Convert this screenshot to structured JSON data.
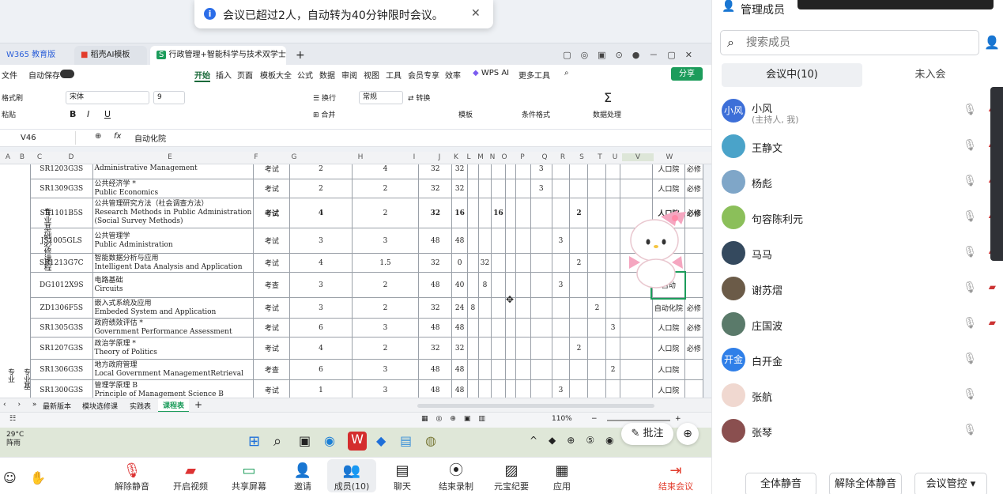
{
  "toast": {
    "text": "会议已超过2人，自动转为40分钟限时会议。",
    "close": "✕",
    "info": "i"
  },
  "tabs": [
    {
      "label": "W365 教育版"
    },
    {
      "label": "稻壳AI模板"
    },
    {
      "label": "行政管理+智能科学与技术双学士"
    },
    {
      "close": "✕",
      "add": "+"
    }
  ],
  "menu": {
    "file": "文件",
    "autosave": "自动保存",
    "items": [
      "开始",
      "插入",
      "页面",
      "模板大全",
      "公式",
      "数据",
      "审阅",
      "视图",
      "工具",
      "会员专享",
      "效率"
    ],
    "wpsai": "WPS AI",
    "more": "更多工具",
    "share": "分享"
  },
  "ribbon": {
    "format_painter": "格式刷",
    "paste": "粘贴",
    "font": "宋体",
    "size": "9",
    "wrap": "换行",
    "merge": "合并",
    "numfmt": "常规",
    "convert": "转换",
    "template": "模板",
    "condfmt": "条件格式",
    "dataproc": "数据处理",
    "bold": "B",
    "italic": "I",
    "underline": "U"
  },
  "formula_bar": {
    "cell": "V46",
    "fx": "fx",
    "content": "自动化院"
  },
  "columns": [
    "A",
    "B",
    "C",
    "D",
    "E",
    "F",
    "G",
    "H",
    "I",
    "J",
    "K",
    "L",
    "M",
    "N",
    "O",
    "P",
    "Q",
    "R",
    "S",
    "T",
    "U",
    "V",
    "W"
  ],
  "group_label_1": "专业基础必修课程",
  "group_label_2": "专业",
  "group_label_3": "专业基",
  "rows": [
    {
      "code": "SR1203G3S",
      "cn": "",
      "en": "Administrative Management",
      "exam": "考试",
      "g": "2",
      "h": "4",
      "i": "32",
      "j": "32",
      "k": "",
      "l": "",
      "m": "",
      "p": "3",
      "q": "",
      "r": "",
      "s": "",
      "t": "",
      "v": "人口院",
      "w": "必修"
    },
    {
      "code": "SR1309G3S",
      "cn": "公共经济学 *",
      "en": "Public Economics",
      "exam": "考试",
      "g": "2",
      "h": "2",
      "i": "32",
      "j": "32",
      "k": "",
      "l": "",
      "m": "",
      "p": "3",
      "q": "",
      "r": "",
      "s": "",
      "t": "",
      "v": "人口院",
      "w": "必修"
    },
    {
      "code": "SR1101B5S",
      "cn": "公共管理研究方法（社会调查方法）",
      "en": "Research Methods in Public Administration",
      "en2": "(Social Survey Methods)",
      "exam": "考试",
      "g": "4",
      "h": "2",
      "i": "32",
      "j": "16",
      "k": "",
      "l": "",
      "m": "16",
      "p": "",
      "q": "",
      "r": "2",
      "s": "",
      "t": "",
      "v": "人口院",
      "w": "必修"
    },
    {
      "code": "JS1005GLS",
      "cn": "公共管理学",
      "en": "Public Administration",
      "exam": "考试",
      "g": "3",
      "h": "3",
      "i": "48",
      "j": "48",
      "k": "",
      "l": "",
      "m": "",
      "p": "",
      "q": "3",
      "r": "",
      "s": "",
      "t": "",
      "v": "",
      "w": ""
    },
    {
      "code": "SR1213G7C",
      "cn": "智能数据分析与应用",
      "en": "Intelligent Data Analysis and Application",
      "exam": "考试",
      "g": "4",
      "h": "1.5",
      "i": "32",
      "j": "0",
      "k": "",
      "l": "32",
      "m": "",
      "p": "",
      "q": "",
      "r": "2",
      "s": "",
      "t": "",
      "v": "",
      "w": ""
    },
    {
      "code": "DG1012X9S",
      "cn": "电路基础",
      "en": "Circuits",
      "exam": "考查",
      "g": "3",
      "h": "2",
      "i": "48",
      "j": "40",
      "k": "",
      "l": "8",
      "m": "",
      "p": "",
      "q": "3",
      "r": "",
      "s": "",
      "t": "",
      "v": "自动",
      "w": ""
    },
    {
      "code": "ZD1306F5S",
      "cn": "嵌入式系统及应用",
      "en": "Embeded System and Application",
      "exam": "考试",
      "g": "3",
      "h": "2",
      "i": "32",
      "j": "24",
      "k": "8",
      "l": "",
      "m": "",
      "p": "",
      "q": "",
      "r": "",
      "s": "2",
      "t": "",
      "v": "自动化院",
      "w": "必修"
    },
    {
      "code": "SR1305G3S",
      "cn": "政府绩效评估 *",
      "en": "Government Performance Assessment",
      "exam": "考试",
      "g": "6",
      "h": "3",
      "i": "48",
      "j": "48",
      "k": "",
      "l": "",
      "m": "",
      "p": "",
      "q": "",
      "r": "",
      "s": "",
      "t": "3",
      "v": "人口院",
      "w": "必修"
    },
    {
      "code": "SR1207G3S",
      "cn": "政治学原理 *",
      "en": "Theory of Politics",
      "exam": "考试",
      "g": "4",
      "h": "2",
      "i": "32",
      "j": "32",
      "k": "",
      "l": "",
      "m": "",
      "p": "",
      "q": "",
      "r": "2",
      "s": "",
      "t": "",
      "v": "人口院",
      "w": "必修"
    },
    {
      "code": "SR1306G3S",
      "cn": "地方政府管理",
      "en": "Local Government ManagementRetrieval",
      "exam": "考查",
      "g": "6",
      "h": "3",
      "i": "48",
      "j": "48",
      "k": "",
      "l": "",
      "m": "",
      "p": "",
      "q": "",
      "r": "",
      "s": "",
      "t": "2",
      "v": "人口院",
      "w": ""
    },
    {
      "code": "SR1300G3S",
      "cn": "管理学原理 B",
      "en": "Principle of Management Science B",
      "exam": "考试",
      "g": "1",
      "h": "3",
      "i": "48",
      "j": "48",
      "k": "",
      "l": "",
      "m": "",
      "p": "",
      "q": "3",
      "r": "",
      "s": "",
      "t": "",
      "v": "人口院",
      "w": ""
    }
  ],
  "sheet_tabs": [
    "最新版本",
    "模块选修课",
    "实践表",
    "课程表"
  ],
  "zoom": "110%",
  "status_icons": {
    "annotate": "批注"
  },
  "weather": {
    "temp": "29°C",
    "desc": "阵雨"
  },
  "toolbar": [
    "解除静音",
    "开启视频",
    "共享屏幕",
    "邀请",
    "成员(10)",
    "聊天",
    "结束录制",
    "元宝纪要",
    "应用",
    "结束会议"
  ],
  "panel": {
    "title": "管理成员",
    "search_placeholder": "搜索成员",
    "tab_in": "会议中(10)",
    "tab_out": "未入会",
    "members": [
      {
        "name": "小风",
        "role": "(主持人, 我)",
        "avatar": "小风",
        "color": "#3d6fd8"
      },
      {
        "name": "王静文",
        "role": "",
        "avatar": "",
        "color": "#4aa3c9"
      },
      {
        "name": "杨彪",
        "role": "",
        "avatar": "",
        "color": "#7fa6c8"
      },
      {
        "name": "句容陈利元",
        "role": "",
        "avatar": "",
        "color": "#8bbf5a"
      },
      {
        "name": "马马",
        "role": "",
        "avatar": "",
        "color": "#34495e"
      },
      {
        "name": "谢苏熠",
        "role": "",
        "avatar": "",
        "color": "#6b5b48"
      },
      {
        "name": "庄国波",
        "role": "",
        "avatar": "",
        "color": "#5a7a6a"
      },
      {
        "name": "白开金",
        "role": "",
        "avatar": "开金",
        "color": "#2f7fe8"
      },
      {
        "name": "张航",
        "role": "",
        "avatar": "",
        "color": "#f0d8d0"
      },
      {
        "name": "张琴",
        "role": "",
        "avatar": "",
        "color": "#8a4f4f"
      }
    ],
    "buttons": [
      "全体静音",
      "解除全体静音",
      "会议管控 ▾"
    ]
  }
}
